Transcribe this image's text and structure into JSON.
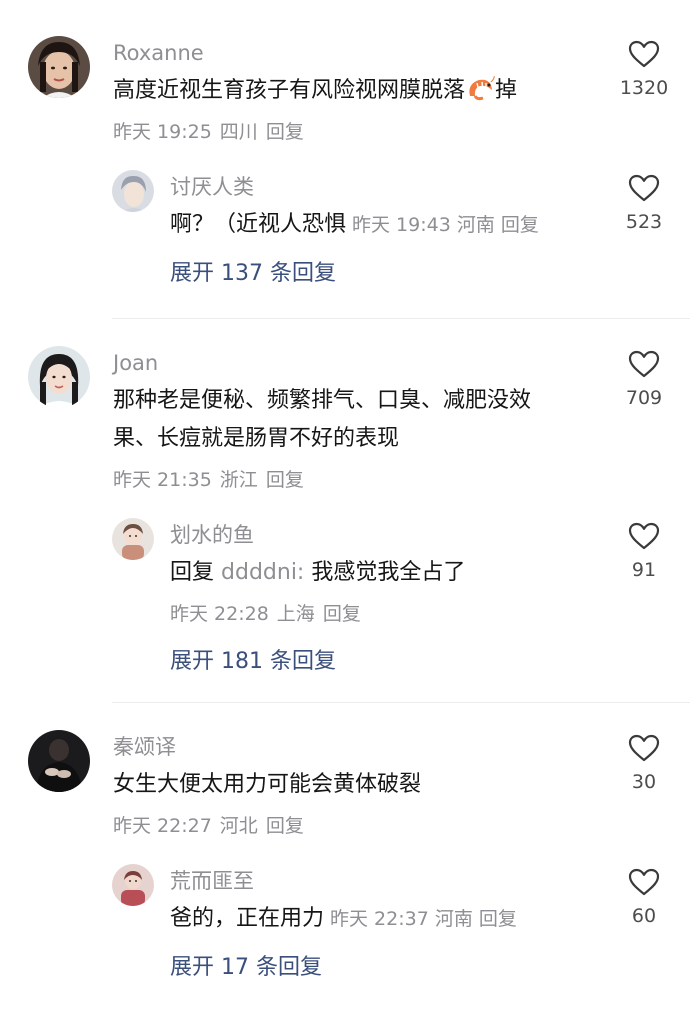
{
  "colors": {
    "username": "#8e8e93",
    "text": "#161616",
    "expand": "#3b4f7d",
    "divider": "#ececec"
  },
  "threads": [
    {
      "comment": {
        "username": "Roxanne",
        "text_before_emoji": "高度近视生育孩子有风险视网膜脱落",
        "emoji": "shrimp-emoji",
        "text_after_emoji": "掉",
        "time": "昨天 19:25",
        "location": "四川",
        "reply_label": "回复",
        "likes": "1320"
      },
      "reply": {
        "username": "讨厌人类",
        "text": "啊？（近视人恐惧",
        "time": "昨天 19:43",
        "location": "河南",
        "reply_label": "回复",
        "likes": "523"
      },
      "expand_label": "展开 137 条回复"
    },
    {
      "comment": {
        "username": "Joan",
        "text_line1": "那种老是便秘、频繁排气、口臭、减肥没效",
        "text_line2": "果、长痘就是肠胃不好的表现",
        "time": "昨天 21:35",
        "location": "浙江",
        "reply_label": "回复",
        "likes": "709"
      },
      "reply": {
        "username": "划水的鱼",
        "reply_prefix": "回复",
        "mention": "ddddni:",
        "text": "我感觉我全占了",
        "time": "昨天 22:28",
        "location": "上海",
        "reply_label": "回复",
        "likes": "91"
      },
      "expand_label": "展开 181 条回复"
    },
    {
      "comment": {
        "username": "秦颂译",
        "text": "女生大便太用力可能会黄体破裂",
        "time": "昨天 22:27",
        "location": "河北",
        "reply_label": "回复",
        "likes": "30"
      },
      "reply": {
        "username": "荒而匪至",
        "text": "爸的，正在用力",
        "time": "昨天 22:37",
        "location": "河南",
        "reply_label": "回复",
        "likes": "60"
      },
      "expand_label": "展开 17 条回复"
    }
  ]
}
